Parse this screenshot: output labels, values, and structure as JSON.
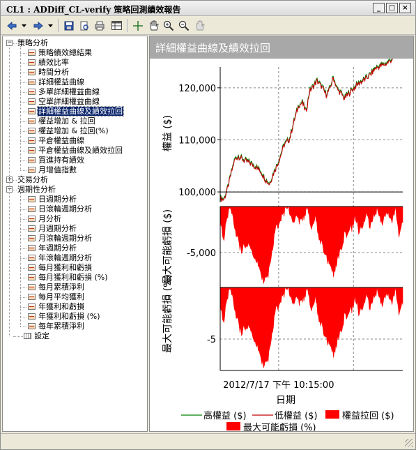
{
  "window": {
    "title": "CL1 : ADDiff_CL-verify 策略回測績效報告",
    "minimize": "_",
    "maximize": "□",
    "close": "×"
  },
  "toolbar": {
    "icons": [
      "nav-back-icon",
      "dropdown-arrow-icon",
      "nav-forward-icon",
      "dropdown-arrow-icon",
      "save-icon",
      "print-preview-icon",
      "print-icon",
      "table-icon",
      "crosshair-icon",
      "pan-hand-icon",
      "zoom-in-icon",
      "zoom-out-icon",
      "reset-zoom-icon"
    ]
  },
  "tree": {
    "groups": [
      {
        "label": "策略分析",
        "expanded": true,
        "items": [
          "策略績效總結果",
          "績效比率",
          "時間分析",
          "詳細權益曲線",
          "多單詳細權益曲線",
          "空單詳細權益曲線",
          "詳細權益曲線及績效拉回",
          "權益增加 & 拉回",
          "權益增加 & 拉回(%)",
          "平倉權益曲線",
          "平倉權益曲線及績效拉回",
          "買進持有績效",
          "月增值指數"
        ]
      },
      {
        "label": "交易分析",
        "expanded": false,
        "items": []
      },
      {
        "label": "週期性分析",
        "expanded": true,
        "items": [
          "日週期分析",
          "日滾輪週期分析",
          "月分析",
          "月週期分析",
          "月滾輪週期分析",
          "年週期分析",
          "年滾輪週期分析",
          "每月獲利和虧損",
          "每月獲利和虧損 (%)",
          "每月累積淨利",
          "每月平均獲利",
          "年獲利和虧損",
          "年獲利和虧損 (%)",
          "每年累積淨利"
        ]
      }
    ],
    "settings_label": "設定",
    "selected": "詳細權益曲線及績效拉回"
  },
  "panel": {
    "title": "詳細權益曲線及績效拉回"
  },
  "chart_data": {
    "type": "line",
    "title": "詳細權益曲線及績效拉回",
    "xlabel": "日期",
    "x_tick_label": "2012/7/17 下午 10:15:00",
    "panels": [
      {
        "ylabel": "權益 ($)",
        "y_ticks": [
          "120,000",
          "110,000",
          "100,000"
        ],
        "ylim": [
          98000,
          124000
        ],
        "series": [
          {
            "name": "高權益 ($)",
            "color": "#008000"
          },
          {
            "name": "低權益 ($)",
            "color": "#c00000"
          }
        ],
        "points": [
          [
            0,
            98700
          ],
          [
            0.02,
            98500
          ],
          [
            0.04,
            100500
          ],
          [
            0.06,
            103500
          ],
          [
            0.08,
            106200
          ],
          [
            0.1,
            106800
          ],
          [
            0.13,
            106000
          ],
          [
            0.16,
            105600
          ],
          [
            0.19,
            104900
          ],
          [
            0.22,
            104000
          ],
          [
            0.25,
            102200
          ],
          [
            0.27,
            101500
          ],
          [
            0.29,
            103400
          ],
          [
            0.32,
            105800
          ],
          [
            0.35,
            109000
          ],
          [
            0.38,
            110100
          ],
          [
            0.4,
            113000
          ],
          [
            0.43,
            116600
          ],
          [
            0.45,
            117100
          ],
          [
            0.47,
            115300
          ],
          [
            0.49,
            119400
          ],
          [
            0.51,
            120200
          ],
          [
            0.53,
            121300
          ],
          [
            0.56,
            120000
          ],
          [
            0.58,
            118600
          ],
          [
            0.6,
            119700
          ],
          [
            0.62,
            122000
          ],
          [
            0.64,
            119700
          ],
          [
            0.66,
            119000
          ],
          [
            0.68,
            117900
          ],
          [
            0.7,
            118700
          ],
          [
            0.73,
            119800
          ],
          [
            0.76,
            120900
          ],
          [
            0.79,
            121500
          ],
          [
            0.82,
            122400
          ],
          [
            0.85,
            123700
          ],
          [
            0.88,
            124200
          ],
          [
            0.91,
            124600
          ],
          [
            0.94,
            125400
          ],
          [
            0.96,
            127000
          ],
          [
            0.98,
            126000
          ],
          [
            1.0,
            126400
          ]
        ]
      },
      {
        "ylabel": "最大可能虧損 ($)",
        "y_tick": "-5,000",
        "series": [
          {
            "name": "權益拉回 ($)",
            "color": "#ff0000"
          }
        ],
        "points": [
          [
            0,
            0.2
          ],
          [
            0.02,
            0.4
          ],
          [
            0.04,
            0.1
          ],
          [
            0.06,
            0.0
          ],
          [
            0.08,
            0.25
          ],
          [
            0.1,
            0.45
          ],
          [
            0.12,
            0.55
          ],
          [
            0.14,
            0.45
          ],
          [
            0.16,
            0.5
          ],
          [
            0.18,
            0.6
          ],
          [
            0.2,
            0.7
          ],
          [
            0.22,
            0.8
          ],
          [
            0.24,
            0.95
          ],
          [
            0.26,
            0.9
          ],
          [
            0.28,
            0.6
          ],
          [
            0.3,
            0.3
          ],
          [
            0.32,
            0.2
          ],
          [
            0.34,
            0.1
          ],
          [
            0.36,
            0.0
          ],
          [
            0.38,
            0.05
          ],
          [
            0.4,
            0.15
          ],
          [
            0.42,
            0.05
          ],
          [
            0.44,
            0.2
          ],
          [
            0.46,
            0.1
          ],
          [
            0.48,
            0.0
          ],
          [
            0.5,
            0.25
          ],
          [
            0.52,
            0.1
          ],
          [
            0.54,
            0.35
          ],
          [
            0.56,
            0.5
          ],
          [
            0.58,
            0.6
          ],
          [
            0.6,
            0.75
          ],
          [
            0.62,
            0.85
          ],
          [
            0.64,
            0.7
          ],
          [
            0.66,
            0.55
          ],
          [
            0.68,
            0.35
          ],
          [
            0.7,
            0.3
          ],
          [
            0.72,
            0.25
          ],
          [
            0.74,
            0.1
          ],
          [
            0.76,
            0.3
          ],
          [
            0.78,
            0.2
          ],
          [
            0.8,
            0.1
          ],
          [
            0.82,
            0.25
          ],
          [
            0.84,
            0.1
          ],
          [
            0.86,
            0.0
          ],
          [
            0.88,
            0.2
          ],
          [
            0.9,
            0.1
          ],
          [
            0.92,
            0.05
          ],
          [
            0.94,
            0.15
          ],
          [
            0.96,
            0.0
          ],
          [
            0.98,
            0.35
          ],
          [
            1.0,
            0.15
          ]
        ]
      },
      {
        "ylabel": "最大可能虧損 (%)",
        "y_tick": "-5",
        "series": [
          {
            "name": "最大可能虧損 (%)",
            "color": "#ff0000"
          }
        ],
        "points": [
          [
            0,
            0.25
          ],
          [
            0.02,
            0.4
          ],
          [
            0.04,
            0.1
          ],
          [
            0.06,
            0.0
          ],
          [
            0.08,
            0.25
          ],
          [
            0.1,
            0.45
          ],
          [
            0.12,
            0.55
          ],
          [
            0.14,
            0.45
          ],
          [
            0.16,
            0.5
          ],
          [
            0.18,
            0.6
          ],
          [
            0.2,
            0.72
          ],
          [
            0.22,
            0.82
          ],
          [
            0.24,
            0.97
          ],
          [
            0.26,
            0.92
          ],
          [
            0.28,
            0.6
          ],
          [
            0.3,
            0.3
          ],
          [
            0.32,
            0.2
          ],
          [
            0.34,
            0.1
          ],
          [
            0.36,
            0.0
          ],
          [
            0.38,
            0.05
          ],
          [
            0.4,
            0.15
          ],
          [
            0.42,
            0.05
          ],
          [
            0.44,
            0.2
          ],
          [
            0.46,
            0.1
          ],
          [
            0.48,
            0.0
          ],
          [
            0.5,
            0.25
          ],
          [
            0.52,
            0.1
          ],
          [
            0.54,
            0.35
          ],
          [
            0.56,
            0.5
          ],
          [
            0.58,
            0.6
          ],
          [
            0.6,
            0.72
          ],
          [
            0.62,
            0.82
          ],
          [
            0.64,
            0.68
          ],
          [
            0.66,
            0.55
          ],
          [
            0.68,
            0.35
          ],
          [
            0.7,
            0.3
          ],
          [
            0.72,
            0.25
          ],
          [
            0.74,
            0.1
          ],
          [
            0.76,
            0.3
          ],
          [
            0.78,
            0.2
          ],
          [
            0.8,
            0.1
          ],
          [
            0.82,
            0.25
          ],
          [
            0.84,
            0.1
          ],
          [
            0.86,
            0.0
          ],
          [
            0.88,
            0.2
          ],
          [
            0.9,
            0.1
          ],
          [
            0.92,
            0.05
          ],
          [
            0.94,
            0.15
          ],
          [
            0.96,
            0.0
          ],
          [
            0.98,
            0.3
          ],
          [
            1.0,
            0.15
          ]
        ]
      }
    ],
    "legend": [
      {
        "name": "高權益 ($)",
        "color": "#008000",
        "style": "line"
      },
      {
        "name": "低權益 ($)",
        "color": "#c00000",
        "style": "line"
      },
      {
        "name": "權益拉回 ($)",
        "color": "#ff0000",
        "style": "box"
      },
      {
        "name": "最大可能虧損 (%)",
        "color": "#ff0000",
        "style": "box"
      }
    ],
    "grid": true
  }
}
